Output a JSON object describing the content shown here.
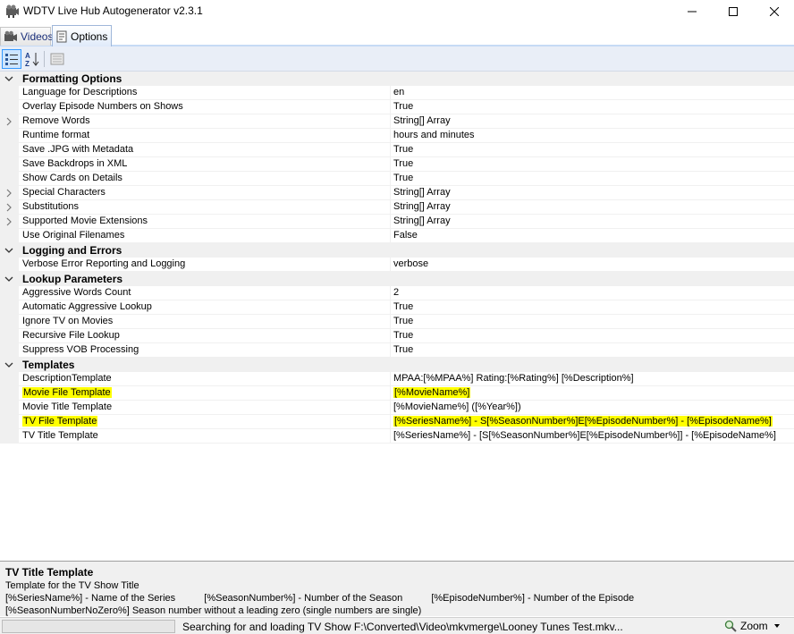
{
  "window": {
    "title": "WDTV Live Hub Autogenerator v2.3.1"
  },
  "tabs": [
    {
      "label": "Videos",
      "selected": false
    },
    {
      "label": "Options",
      "selected": true
    }
  ],
  "toolbar": {
    "categorized_icon": "categorized-icon",
    "alphabetical_icon": "sort-az-icon",
    "pages_icon": "property-pages-icon"
  },
  "categories": [
    {
      "label": "Formatting Options",
      "properties": [
        {
          "name": "Language for Descriptions",
          "value": "en",
          "expandable": false
        },
        {
          "name": "Overlay Episode Numbers on Shows",
          "value": "True",
          "expandable": false
        },
        {
          "name": "Remove Words",
          "value": "String[] Array",
          "expandable": true
        },
        {
          "name": "Runtime format",
          "value": "hours and minutes",
          "expandable": false
        },
        {
          "name": "Save .JPG with Metadata",
          "value": "True",
          "expandable": false
        },
        {
          "name": "Save Backdrops in XML",
          "value": "True",
          "expandable": false
        },
        {
          "name": "Show Cards on Details",
          "value": "True",
          "expandable": false
        },
        {
          "name": "Special Characters",
          "value": "String[] Array",
          "expandable": true
        },
        {
          "name": "Substitutions",
          "value": "String[] Array",
          "expandable": true
        },
        {
          "name": "Supported Movie Extensions",
          "value": "String[] Array",
          "expandable": true
        },
        {
          "name": "Use Original Filenames",
          "value": "False",
          "expandable": false
        }
      ]
    },
    {
      "label": "Logging and Errors",
      "properties": [
        {
          "name": "Verbose Error Reporting and Logging",
          "value": "verbose",
          "expandable": false
        }
      ]
    },
    {
      "label": "Lookup Parameters",
      "properties": [
        {
          "name": "Aggressive Words Count",
          "value": "2",
          "expandable": false
        },
        {
          "name": "Automatic Aggressive Lookup",
          "value": "True",
          "expandable": false
        },
        {
          "name": "Ignore TV on Movies",
          "value": "True",
          "expandable": false
        },
        {
          "name": "Recursive File Lookup",
          "value": "True",
          "expandable": false
        },
        {
          "name": "Suppress VOB Processing",
          "value": "True",
          "expandable": false
        }
      ]
    },
    {
      "label": "Templates",
      "properties": [
        {
          "name": "DescriptionTemplate",
          "value": "MPAA:[%MPAA%] Rating:[%Rating%] [%Description%]",
          "expandable": false
        },
        {
          "name": "Movie File Template",
          "value": "[%MovieName%]",
          "expandable": false
        },
        {
          "name": "Movie Title Template",
          "value": "[%MovieName%] ([%Year%])",
          "expandable": false
        },
        {
          "name": "TV File Template",
          "value": "[%SeriesName%] - S[%SeasonNumber%]E[%EpisodeNumber%] - [%EpisodeName%]",
          "expandable": false
        },
        {
          "name": "TV Title Template",
          "value": "[%SeriesName%] - [S[%SeasonNumber%]E[%EpisodeNumber%]] - [%EpisodeName%]",
          "expandable": false
        }
      ]
    }
  ],
  "description": {
    "title": "TV Title Template",
    "subtitle": "Template for the TV Show Title",
    "tokens": [
      "[%SeriesName%] - Name of the Series",
      "[%SeasonNumber%] - Number of the Season",
      "[%EpisodeNumber%] - Number of the Episode"
    ],
    "line3": "[%SeasonNumberNoZero%] Season number without a leading zero (single numbers are single)"
  },
  "status": {
    "progress": 0,
    "text": "Searching for and loading TV Show F:\\Converted\\Video\\mkvmerge\\Looney Tunes Test.mkv...",
    "zoom_label": "Zoom"
  },
  "colors": {
    "highlight": "#ffff00",
    "category_bg": "#f0f0f0",
    "progress_fill": "#06b025"
  }
}
